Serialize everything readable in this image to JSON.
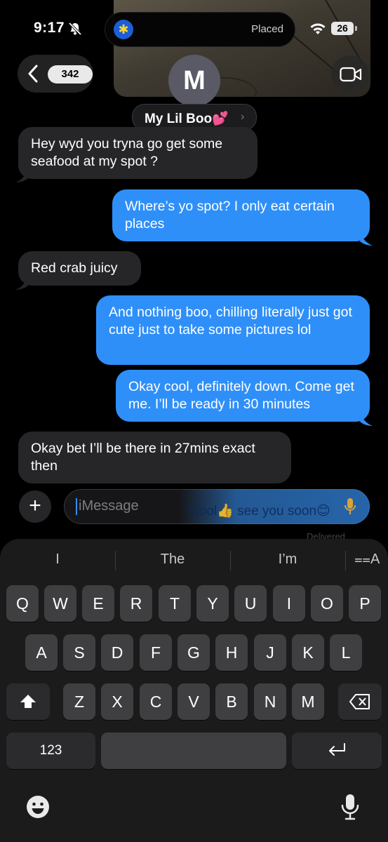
{
  "status_bar": {
    "time": "9:17",
    "island_label": "Placed",
    "battery": "26"
  },
  "header": {
    "back_count": "342",
    "avatar_initial": "M",
    "contact_name": "My Lil Boo💕",
    "chevron": "›"
  },
  "messages": [
    {
      "direction": "incoming",
      "text": "Hey wyd you tryna go get some seafood at my spot ?"
    },
    {
      "direction": "outgoing",
      "text": "Where’s yo spot? I only eat certain places"
    },
    {
      "direction": "incoming",
      "text": "Red crab juicy"
    },
    {
      "direction": "outgoing",
      "text": "And nothing boo, chilling literally just got cute just to take some pictures lol"
    },
    {
      "direction": "outgoing",
      "text": "Okay cool, definitely down. Come get me. I’ll be ready in 30 minutes"
    },
    {
      "direction": "incoming",
      "text": "Okay bet I’ll be there in 27mins exact then"
    }
  ],
  "compose": {
    "plus": "+",
    "placeholder": "iMessage",
    "draft_preview": "Cool👍 see you soon😊",
    "delivered_label": "Delivered"
  },
  "keyboard": {
    "suggestions": [
      "I",
      "The",
      "I’m"
    ],
    "text_size_label": "⩵A",
    "row1": [
      "Q",
      "W",
      "E",
      "R",
      "T",
      "Y",
      "U",
      "I",
      "O",
      "P"
    ],
    "row2": [
      "A",
      "S",
      "D",
      "F",
      "G",
      "H",
      "J",
      "K",
      "L"
    ],
    "row3": [
      "Z",
      "X",
      "C",
      "V",
      "B",
      "N",
      "M"
    ],
    "numbers_key": "123",
    "return_key": "↵"
  },
  "colors": {
    "outgoing_bubble": "#2f8ff8",
    "incoming_bubble": "#262628",
    "background": "#000000",
    "key": "#3f3f41"
  },
  "icons": [
    "bell-slash-icon",
    "wifi-icon",
    "back-chevron-icon",
    "video-camera-icon",
    "microphone-icon",
    "shift-icon",
    "delete-icon",
    "return-icon",
    "emoji-icon",
    "dictation-mic-icon"
  ]
}
